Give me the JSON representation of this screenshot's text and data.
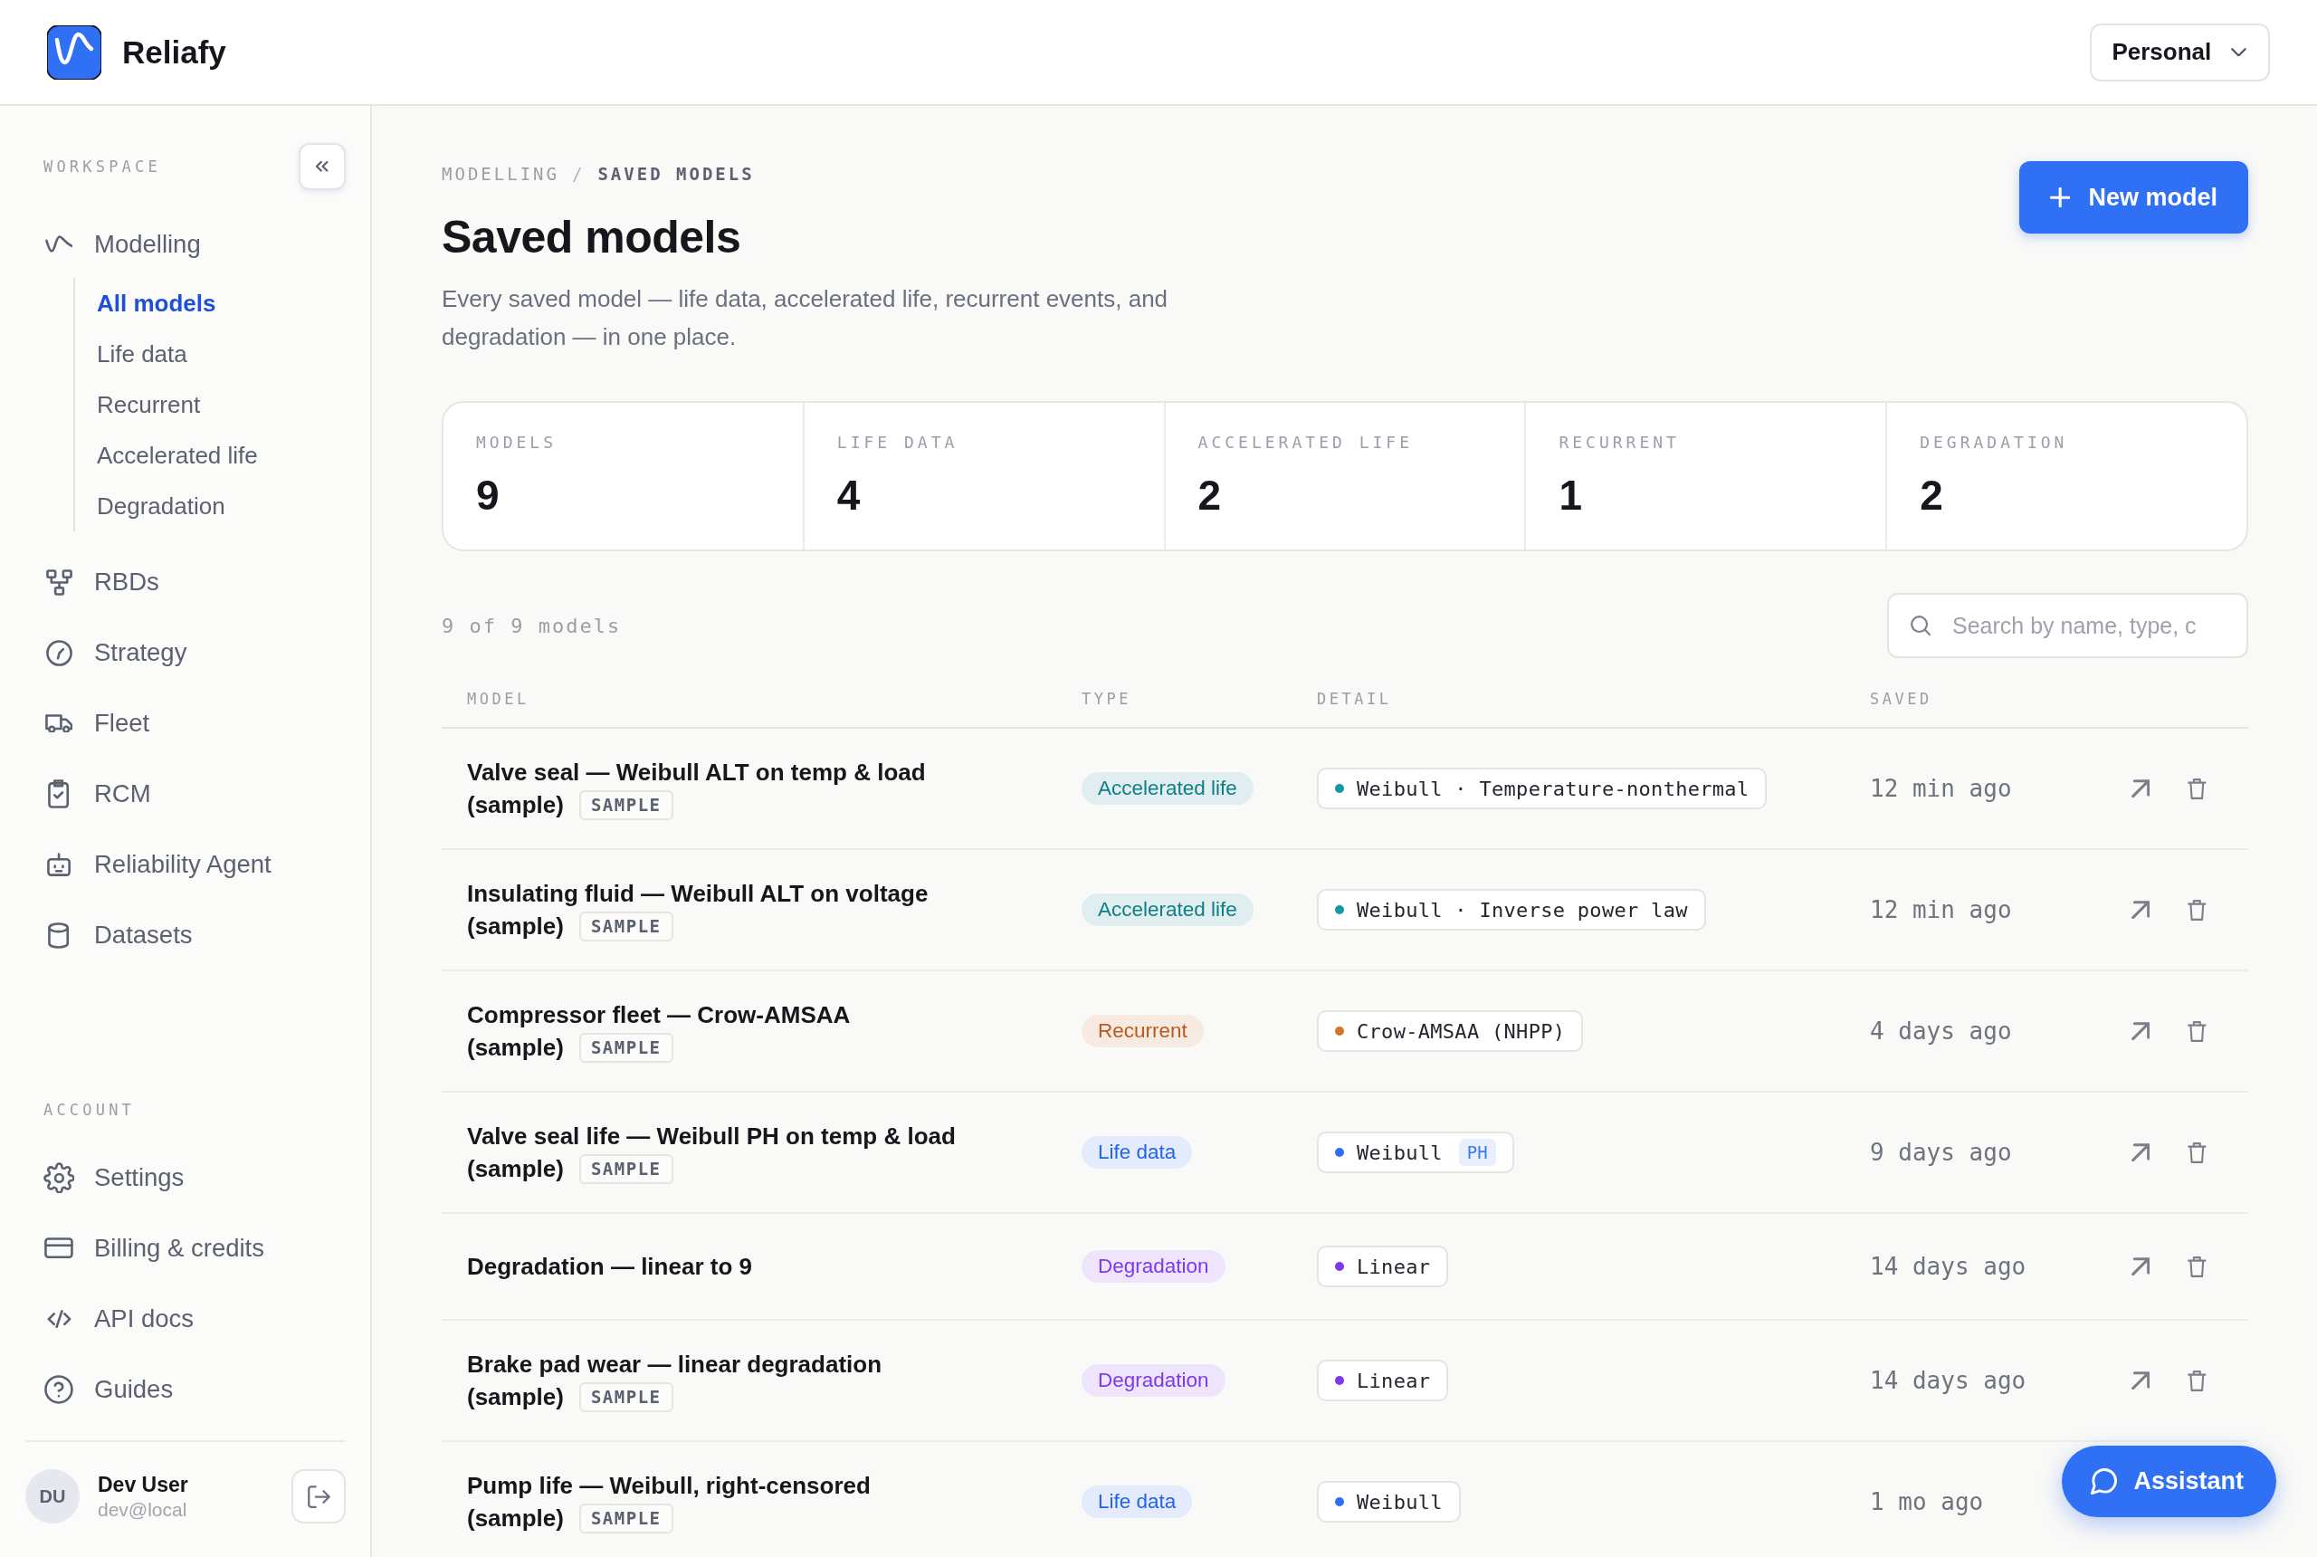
{
  "header": {
    "brand": "Reliafy",
    "workspace": "Personal"
  },
  "sidebar": {
    "sections": [
      {
        "label": "WORKSPACE",
        "items": [
          {
            "label": "Modelling",
            "selected": false,
            "children": [
              {
                "label": "All models",
                "selected": true
              },
              {
                "label": "Life data",
                "selected": false
              },
              {
                "label": "Recurrent",
                "selected": false
              },
              {
                "label": "Accelerated life",
                "selected": false
              },
              {
                "label": "Degradation",
                "selected": false
              }
            ]
          },
          {
            "label": "RBDs",
            "selected": false
          },
          {
            "label": "Strategy",
            "selected": false
          },
          {
            "label": "Fleet",
            "selected": false
          },
          {
            "label": "RCM",
            "selected": false
          },
          {
            "label": "Reliability Agent",
            "selected": false
          },
          {
            "label": "Datasets",
            "selected": false
          }
        ]
      },
      {
        "label": "ACCOUNT",
        "items": [
          {
            "label": "Settings",
            "selected": false
          },
          {
            "label": "Billing & credits",
            "selected": false
          },
          {
            "label": "API docs",
            "selected": false
          },
          {
            "label": "Guides",
            "selected": false
          }
        ]
      }
    ],
    "user": {
      "initials": "DU",
      "name": "Dev User",
      "email": "dev@local"
    }
  },
  "main": {
    "breadcrumb": {
      "items": [
        "MODELLING",
        "SAVED MODELS"
      ],
      "separator": "/"
    },
    "title": "Saved models",
    "description": "Every saved model — life data, accelerated life, recurrent events, and degradation — in one place.",
    "new_button": "New model",
    "stats": [
      {
        "label": "MODELS",
        "value": "9"
      },
      {
        "label": "LIFE DATA",
        "value": "4"
      },
      {
        "label": "ACCELERATED LIFE",
        "value": "2"
      },
      {
        "label": "RECURRENT",
        "value": "1"
      },
      {
        "label": "DEGRADATION",
        "value": "2"
      }
    ],
    "count": "9 of 9 models",
    "search": {
      "placeholder": "Search by name, type, c"
    },
    "table": {
      "columns": [
        "MODEL",
        "TYPE",
        "DETAIL",
        "SAVED"
      ],
      "rows": [
        {
          "name": "Valve seal — Weibull ALT on temp & load",
          "note": "(sample)",
          "badge": "SAMPLE",
          "type": {
            "label": "Accelerated life",
            "color": "#0e7f86"
          },
          "detail": {
            "text": "Weibull · Temperature-nonthermal",
            "color": "#1399a5"
          },
          "saved": "12 min ago",
          "actions": [
            {
              "kind": "open"
            },
            {
              "kind": "delete"
            }
          ]
        },
        {
          "name": "Insulating fluid — Weibull ALT on voltage",
          "note": "(sample)",
          "badge": "SAMPLE",
          "type": {
            "label": "Accelerated life",
            "color": "#0e7f86"
          },
          "detail": {
            "text": "Weibull · Inverse power law",
            "color": "#1399a5"
          },
          "saved": "12 min ago",
          "actions": [
            {
              "kind": "open"
            },
            {
              "kind": "delete"
            }
          ]
        },
        {
          "name": "Compressor fleet — Crow-AMSAA",
          "note": "(sample)",
          "badge": "SAMPLE",
          "type": {
            "label": "Recurrent",
            "color": "#b95a1c"
          },
          "detail": {
            "text": "Crow-AMSAA (NHPP)",
            "color": "#d4752b"
          },
          "saved": "4 days ago",
          "actions": [
            {
              "kind": "open"
            },
            {
              "kind": "delete"
            }
          ]
        },
        {
          "name": "Valve seal life — Weibull PH on temp & load",
          "note": "(sample)",
          "badge": "SAMPLE",
          "type": {
            "label": "Life data",
            "color": "#2563eb"
          },
          "detail": {
            "text": "Weibull",
            "color": "#2f6ff5",
            "tag": "PH"
          },
          "saved": "9 days ago",
          "actions": [
            {
              "kind": "open"
            },
            {
              "kind": "delete"
            }
          ]
        },
        {
          "name": "Degradation — linear to 9",
          "type": {
            "label": "Degradation",
            "color": "#7c3aed"
          },
          "detail": {
            "text": "Linear",
            "color": "#7c3aed"
          },
          "saved": "14 days ago",
          "actions": [
            {
              "kind": "open"
            },
            {
              "kind": "delete"
            }
          ]
        },
        {
          "name": "Brake pad wear — linear degradation",
          "note": "(sample)",
          "badge": "SAMPLE",
          "type": {
            "label": "Degradation",
            "color": "#7c3aed"
          },
          "detail": {
            "text": "Linear",
            "color": "#7c3aed"
          },
          "saved": "14 days ago",
          "actions": [
            {
              "kind": "open"
            },
            {
              "kind": "delete"
            }
          ]
        },
        {
          "name": "Pump life — Weibull, right-censored",
          "note": "(sample)",
          "badge": "SAMPLE",
          "type": {
            "label": "Life data",
            "color": "#2563eb"
          },
          "detail": {
            "text": "Weibull",
            "color": "#2f6ff5"
          },
          "saved": "1 mo ago"
        }
      ]
    }
  },
  "assistant_button": "Assistant"
}
